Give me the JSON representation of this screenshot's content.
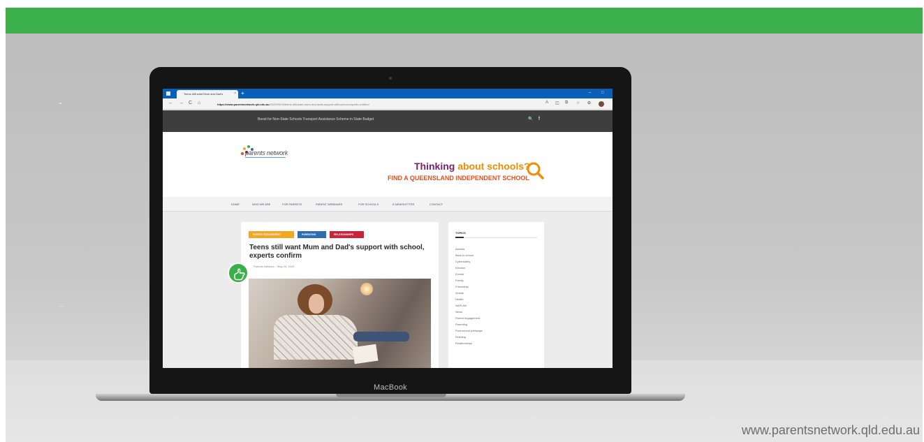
{
  "browser": {
    "tab_title": "Teens still want Mum and Dad's",
    "tab_close": "×",
    "new_tab": "+",
    "url_domain": "https://www.parentsnetwork.qld.edu.au",
    "url_path": "/2022/05/24/teens-still-want-mum-and-dads-support-with-school-experts-confirm/",
    "back_icon": "←",
    "forward_icon": "→",
    "reload_icon": "C",
    "home_icon": "⌂",
    "minimize_icon": "–",
    "maximize_icon": "□",
    "read_aloud_icon": "A",
    "split_icon": "◫",
    "favorite_icon": "☆",
    "collections_icon": "⧉",
    "ext_icon": "✿"
  },
  "site": {
    "ticker": "Boost for Non-State Schools Transport Assistance Scheme in State Budget",
    "search_icon": "🔍",
    "facebook_icon": "f",
    "logo_text": "parents network",
    "ad_line1_a": "Thinking ",
    "ad_line1_b": "about schools?",
    "ad_line2": "FIND A QUEENSLAND INDEPENDENT SCHOOL",
    "nav": [
      "Home",
      "Who we are",
      "For parents",
      "Parent webinars",
      "For schools",
      "E-newsletter",
      "Contact"
    ]
  },
  "article": {
    "chips": [
      {
        "label": "Parent engagement",
        "color": "#f5a623"
      },
      {
        "label": "Parenting",
        "color": "#2e6db4"
      },
      {
        "label": "Relationships",
        "color": "#c8243a"
      }
    ],
    "headline": "Teens still want Mum and Dad's support with school, experts confirm",
    "meta": "Parents Network  –  May 24, 2022"
  },
  "sidebar": {
    "title": "Topics",
    "topics": [
      "Awards",
      "Back to school",
      "Cybersafety",
      "Election",
      "Events",
      "Family",
      "Friendship",
      "Grants",
      "Health",
      "NAPLAN",
      "News",
      "Parent engagement",
      "Parenting",
      "Post-school pathways",
      "Reading",
      "Relationships"
    ]
  },
  "device": {
    "label": "MacBook"
  },
  "footer": {
    "url": "www.parentsnetwork.qld.edu.au"
  },
  "colors": {
    "brand_green": "#3bb04a",
    "browser_blue": "#0a5fb8"
  }
}
